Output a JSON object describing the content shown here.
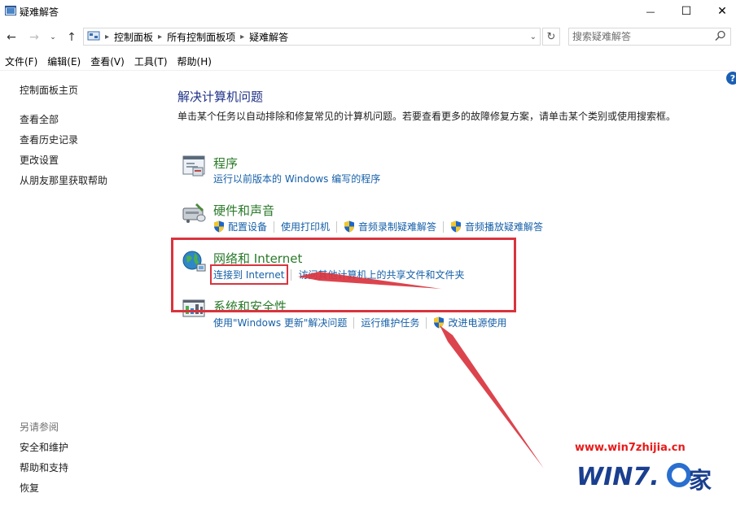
{
  "window": {
    "title": "疑难解答",
    "controls": {
      "minimize": "—",
      "maximize": "☐",
      "close": "✕"
    }
  },
  "address": {
    "breadcrumbs": [
      "控制面板",
      "所有控制面板项",
      "疑难解答"
    ],
    "search_placeholder": "搜索疑难解答"
  },
  "menu": [
    "文件(F)",
    "编辑(E)",
    "查看(V)",
    "工具(T)",
    "帮助(H)"
  ],
  "sidebar": {
    "items": [
      "控制面板主页",
      "查看全部",
      "查看历史记录",
      "更改设置",
      "从朋友那里获取帮助"
    ],
    "see_also_title": "另请参阅",
    "see_also": [
      "安全和维护",
      "帮助和支持",
      "恢复"
    ]
  },
  "main": {
    "heading": "解决计算机问题",
    "description": "单击某个任务以自动排除和修复常见的计算机问题。若要查看更多的故障修复方案，请单击某个类别或使用搜索框。",
    "help_glyph": "?",
    "categories": [
      {
        "title": "程序",
        "links": [
          {
            "label": "运行以前版本的 Windows 编写的程序",
            "shield": false
          }
        ]
      },
      {
        "title": "硬件和声音",
        "links": [
          {
            "label": "配置设备",
            "shield": true
          },
          {
            "label": "使用打印机",
            "shield": false
          },
          {
            "label": "音频录制疑难解答",
            "shield": true
          },
          {
            "label": "音频播放疑难解答",
            "shield": true
          }
        ]
      },
      {
        "title": "网络和 Internet",
        "links": [
          {
            "label": "连接到 Internet",
            "shield": false
          },
          {
            "label": "访问其他计算机上的共享文件和文件夹",
            "shield": false
          }
        ]
      },
      {
        "title": "系统和安全性",
        "links": [
          {
            "label": "使用\"Windows 更新\"解决问题",
            "shield": false
          },
          {
            "label": "运行维护任务",
            "shield": false
          },
          {
            "label": "改进电源使用",
            "shield": true
          }
        ]
      }
    ]
  },
  "watermark": {
    "url": "www.win7zhijia.cn",
    "logo_text": "WIN7.家"
  },
  "colors": {
    "annotation_red": "#d9343e",
    "link_blue": "#1660a8",
    "category_green": "#2a7a2a",
    "heading_blue": "#1e3287"
  }
}
